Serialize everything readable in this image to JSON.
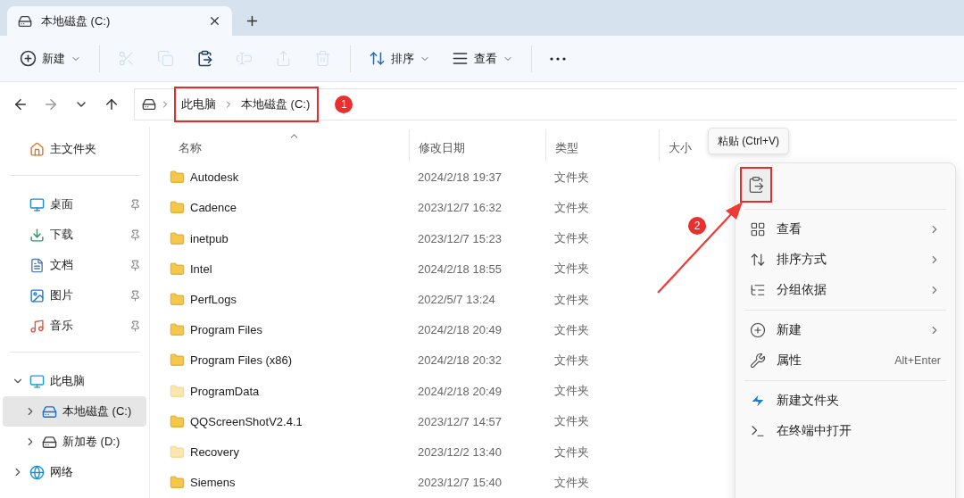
{
  "tabs": [
    {
      "title": "本地磁盘 (C:)",
      "selected": true
    }
  ],
  "toolbar": [
    {
      "kind": "new",
      "label": "新建",
      "caret": true,
      "disabled": false
    },
    {
      "kind": "separator"
    },
    {
      "kind": "cut",
      "disabled": true
    },
    {
      "kind": "copy",
      "disabled": true
    },
    {
      "kind": "paste",
      "disabled": false
    },
    {
      "kind": "rename",
      "disabled": true
    },
    {
      "kind": "share",
      "disabled": true
    },
    {
      "kind": "delete",
      "disabled": true
    },
    {
      "kind": "separator"
    },
    {
      "kind": "sort",
      "label": "排序",
      "caret": true,
      "disabled": false
    },
    {
      "kind": "view",
      "label": "查看",
      "caret": true,
      "disabled": false
    },
    {
      "kind": "separator"
    },
    {
      "kind": "more",
      "disabled": false
    }
  ],
  "address": {
    "crumbs": [
      "此电脑",
      "本地磁盘 (C:)"
    ],
    "highlighted": true,
    "badge": "1"
  },
  "sidebar": {
    "sections": [
      [
        {
          "kind": "home",
          "label": "主文件夹",
          "pinned": false
        }
      ],
      [
        {
          "kind": "desktop",
          "label": "桌面",
          "pinned": true
        },
        {
          "kind": "downloads",
          "label": "下载",
          "pinned": true
        },
        {
          "kind": "documents",
          "label": "文档",
          "pinned": true
        },
        {
          "kind": "pictures",
          "label": "图片",
          "pinned": true
        },
        {
          "kind": "music",
          "label": "音乐",
          "pinned": true
        }
      ],
      [
        {
          "kind": "pc",
          "label": "此电脑",
          "expanded": true,
          "selected": false,
          "children": [
            {
              "kind": "system-drive",
              "label": "本地磁盘 (C:)",
              "expanded": false,
              "selected": true
            },
            {
              "kind": "drive",
              "label": "新加卷 (D:)",
              "expanded": false,
              "selected": false
            }
          ]
        },
        {
          "kind": "network",
          "label": "网络",
          "expanded": false,
          "selected": false
        }
      ]
    ]
  },
  "table": {
    "columns": [
      {
        "label": "名称",
        "sorted": true
      },
      {
        "label": "修改日期",
        "sorted": false
      },
      {
        "label": "类型",
        "sorted": false
      },
      {
        "label": "大小",
        "sorted": false
      }
    ],
    "rows": [
      {
        "name": "Autodesk",
        "modified": "2024/2/18 19:37",
        "type": "文件夹",
        "hidden": false
      },
      {
        "name": "Cadence",
        "modified": "2023/12/7 16:32",
        "type": "文件夹",
        "hidden": false
      },
      {
        "name": "inetpub",
        "modified": "2023/12/7 15:23",
        "type": "文件夹",
        "hidden": false
      },
      {
        "name": "Intel",
        "modified": "2024/2/18 18:55",
        "type": "文件夹",
        "hidden": false
      },
      {
        "name": "PerfLogs",
        "modified": "2022/5/7 13:24",
        "type": "文件夹",
        "hidden": false
      },
      {
        "name": "Program Files",
        "modified": "2024/2/18 20:49",
        "type": "文件夹",
        "hidden": false
      },
      {
        "name": "Program Files (x86)",
        "modified": "2024/2/18 20:32",
        "type": "文件夹",
        "hidden": false
      },
      {
        "name": "ProgramData",
        "modified": "2024/2/18 20:49",
        "type": "文件夹",
        "hidden": true
      },
      {
        "name": "QQScreenShotV2.4.1",
        "modified": "2023/12/7 14:57",
        "type": "文件夹",
        "hidden": false
      },
      {
        "name": "Recovery",
        "modified": "2023/12/2 13:40",
        "type": "文件夹",
        "hidden": true
      },
      {
        "name": "Siemens",
        "modified": "2023/12/7 15:40",
        "type": "文件夹",
        "hidden": false
      }
    ]
  },
  "tooltip": "粘贴 (Ctrl+V)",
  "context_menu": {
    "icon_bar": [
      {
        "kind": "paste",
        "highlighted": true
      }
    ],
    "groups": [
      [
        {
          "kind": "view",
          "label": "查看",
          "submenu": true
        },
        {
          "kind": "sort",
          "label": "排序方式",
          "submenu": true
        },
        {
          "kind": "group",
          "label": "分组依据",
          "submenu": true
        }
      ],
      [
        {
          "kind": "new",
          "label": "新建",
          "submenu": true
        },
        {
          "kind": "properties",
          "label": "属性",
          "shortcut": "Alt+Enter",
          "submenu": false
        }
      ],
      [
        {
          "kind": "new-folder",
          "label": "新建文件夹",
          "submenu": false
        },
        {
          "kind": "terminal",
          "label": "在终端中打开",
          "submenu": false
        }
      ]
    ]
  },
  "callout": {
    "badge": "2"
  }
}
